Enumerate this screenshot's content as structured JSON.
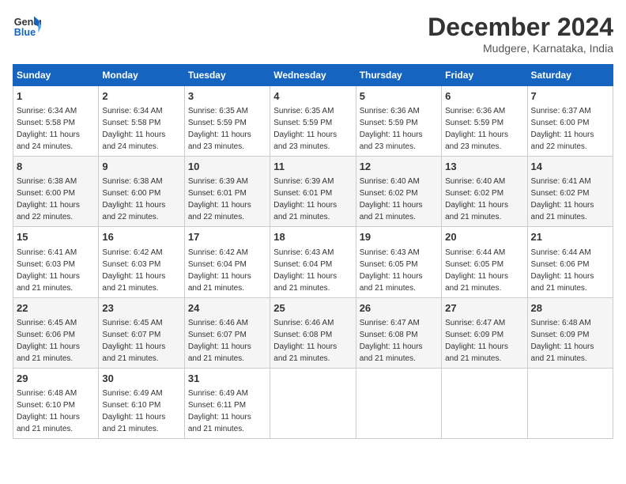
{
  "header": {
    "logo_line1": "General",
    "logo_line2": "Blue",
    "month": "December 2024",
    "location": "Mudgere, Karnataka, India"
  },
  "days_of_week": [
    "Sunday",
    "Monday",
    "Tuesday",
    "Wednesday",
    "Thursday",
    "Friday",
    "Saturday"
  ],
  "weeks": [
    [
      {
        "day": "1",
        "info": "Sunrise: 6:34 AM\nSunset: 5:58 PM\nDaylight: 11 hours\nand 24 minutes."
      },
      {
        "day": "2",
        "info": "Sunrise: 6:34 AM\nSunset: 5:58 PM\nDaylight: 11 hours\nand 24 minutes."
      },
      {
        "day": "3",
        "info": "Sunrise: 6:35 AM\nSunset: 5:59 PM\nDaylight: 11 hours\nand 23 minutes."
      },
      {
        "day": "4",
        "info": "Sunrise: 6:35 AM\nSunset: 5:59 PM\nDaylight: 11 hours\nand 23 minutes."
      },
      {
        "day": "5",
        "info": "Sunrise: 6:36 AM\nSunset: 5:59 PM\nDaylight: 11 hours\nand 23 minutes."
      },
      {
        "day": "6",
        "info": "Sunrise: 6:36 AM\nSunset: 5:59 PM\nDaylight: 11 hours\nand 23 minutes."
      },
      {
        "day": "7",
        "info": "Sunrise: 6:37 AM\nSunset: 6:00 PM\nDaylight: 11 hours\nand 22 minutes."
      }
    ],
    [
      {
        "day": "8",
        "info": "Sunrise: 6:38 AM\nSunset: 6:00 PM\nDaylight: 11 hours\nand 22 minutes."
      },
      {
        "day": "9",
        "info": "Sunrise: 6:38 AM\nSunset: 6:00 PM\nDaylight: 11 hours\nand 22 minutes."
      },
      {
        "day": "10",
        "info": "Sunrise: 6:39 AM\nSunset: 6:01 PM\nDaylight: 11 hours\nand 22 minutes."
      },
      {
        "day": "11",
        "info": "Sunrise: 6:39 AM\nSunset: 6:01 PM\nDaylight: 11 hours\nand 21 minutes."
      },
      {
        "day": "12",
        "info": "Sunrise: 6:40 AM\nSunset: 6:02 PM\nDaylight: 11 hours\nand 21 minutes."
      },
      {
        "day": "13",
        "info": "Sunrise: 6:40 AM\nSunset: 6:02 PM\nDaylight: 11 hours\nand 21 minutes."
      },
      {
        "day": "14",
        "info": "Sunrise: 6:41 AM\nSunset: 6:02 PM\nDaylight: 11 hours\nand 21 minutes."
      }
    ],
    [
      {
        "day": "15",
        "info": "Sunrise: 6:41 AM\nSunset: 6:03 PM\nDaylight: 11 hours\nand 21 minutes."
      },
      {
        "day": "16",
        "info": "Sunrise: 6:42 AM\nSunset: 6:03 PM\nDaylight: 11 hours\nand 21 minutes."
      },
      {
        "day": "17",
        "info": "Sunrise: 6:42 AM\nSunset: 6:04 PM\nDaylight: 11 hours\nand 21 minutes."
      },
      {
        "day": "18",
        "info": "Sunrise: 6:43 AM\nSunset: 6:04 PM\nDaylight: 11 hours\nand 21 minutes."
      },
      {
        "day": "19",
        "info": "Sunrise: 6:43 AM\nSunset: 6:05 PM\nDaylight: 11 hours\nand 21 minutes."
      },
      {
        "day": "20",
        "info": "Sunrise: 6:44 AM\nSunset: 6:05 PM\nDaylight: 11 hours\nand 21 minutes."
      },
      {
        "day": "21",
        "info": "Sunrise: 6:44 AM\nSunset: 6:06 PM\nDaylight: 11 hours\nand 21 minutes."
      }
    ],
    [
      {
        "day": "22",
        "info": "Sunrise: 6:45 AM\nSunset: 6:06 PM\nDaylight: 11 hours\nand 21 minutes."
      },
      {
        "day": "23",
        "info": "Sunrise: 6:45 AM\nSunset: 6:07 PM\nDaylight: 11 hours\nand 21 minutes."
      },
      {
        "day": "24",
        "info": "Sunrise: 6:46 AM\nSunset: 6:07 PM\nDaylight: 11 hours\nand 21 minutes."
      },
      {
        "day": "25",
        "info": "Sunrise: 6:46 AM\nSunset: 6:08 PM\nDaylight: 11 hours\nand 21 minutes."
      },
      {
        "day": "26",
        "info": "Sunrise: 6:47 AM\nSunset: 6:08 PM\nDaylight: 11 hours\nand 21 minutes."
      },
      {
        "day": "27",
        "info": "Sunrise: 6:47 AM\nSunset: 6:09 PM\nDaylight: 11 hours\nand 21 minutes."
      },
      {
        "day": "28",
        "info": "Sunrise: 6:48 AM\nSunset: 6:09 PM\nDaylight: 11 hours\nand 21 minutes."
      }
    ],
    [
      {
        "day": "29",
        "info": "Sunrise: 6:48 AM\nSunset: 6:10 PM\nDaylight: 11 hours\nand 21 minutes."
      },
      {
        "day": "30",
        "info": "Sunrise: 6:49 AM\nSunset: 6:10 PM\nDaylight: 11 hours\nand 21 minutes."
      },
      {
        "day": "31",
        "info": "Sunrise: 6:49 AM\nSunset: 6:11 PM\nDaylight: 11 hours\nand 21 minutes."
      },
      {
        "day": "",
        "info": ""
      },
      {
        "day": "",
        "info": ""
      },
      {
        "day": "",
        "info": ""
      },
      {
        "day": "",
        "info": ""
      }
    ]
  ]
}
